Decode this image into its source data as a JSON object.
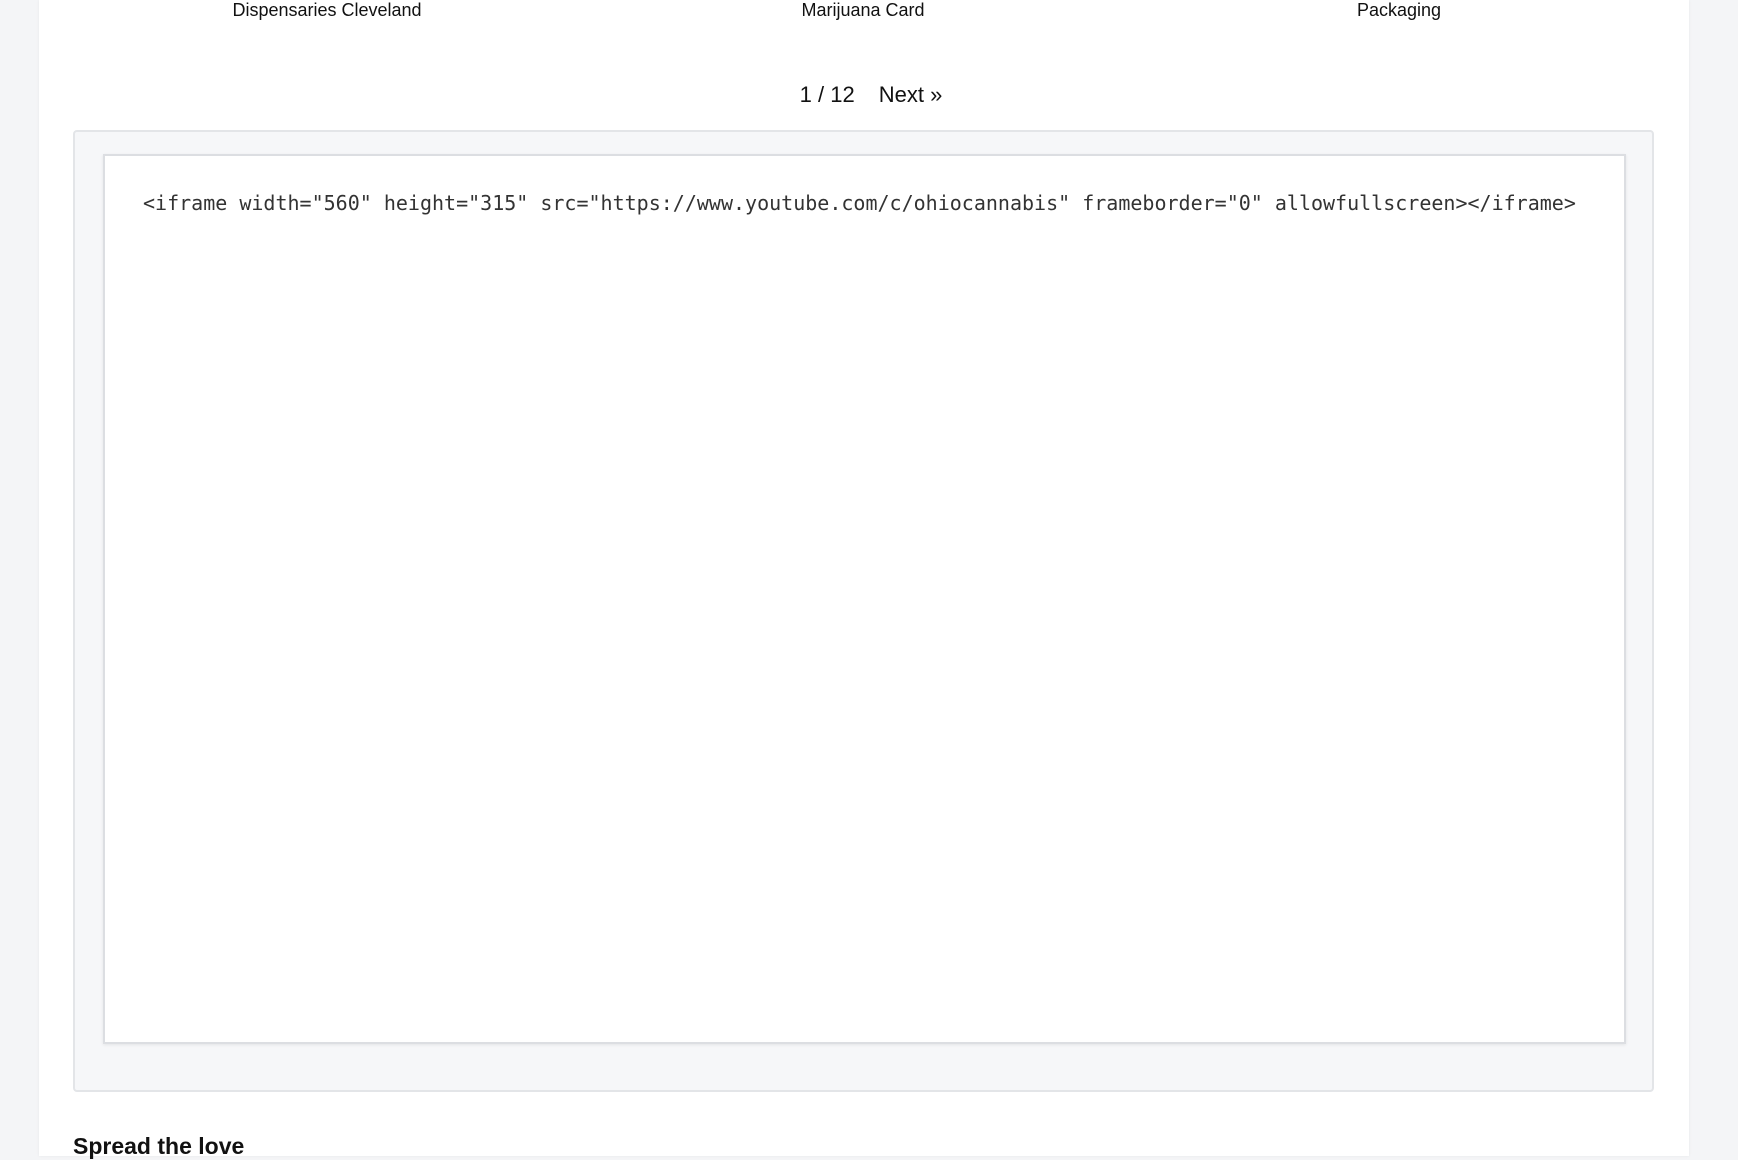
{
  "related_links": [
    {
      "label": "Dispensaries Cleveland"
    },
    {
      "label": "Marijuana Card"
    },
    {
      "label": "Packaging"
    }
  ],
  "pagination": {
    "current": "1",
    "total": "12",
    "count_text": "1 / 12",
    "next_label": "Next »"
  },
  "embed": {
    "code": "<iframe width=\"560\" height=\"315\" src=\"https://www.youtube.com/c/ohiocannabis\" frameborder=\"0\" allowfullscreen></iframe>"
  },
  "share": {
    "heading": "Spread the love"
  },
  "colors": {
    "background": "#f4f5f7",
    "card": "#ffffff",
    "frame": "#f6f7f9",
    "text": "#111111"
  }
}
